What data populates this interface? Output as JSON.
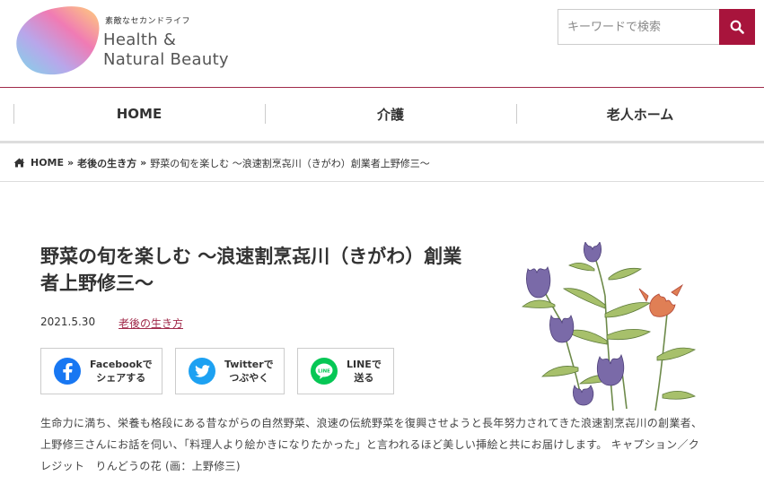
{
  "header": {
    "tagline": "素敵なセカンドライフ",
    "brand_line1": "Health &",
    "brand_line2": "Natural Beauty",
    "search_placeholder": "キーワードで検索"
  },
  "nav": {
    "items": [
      {
        "label": "HOME"
      },
      {
        "label": "介護"
      },
      {
        "label": "老人ホーム"
      }
    ]
  },
  "breadcrumb": {
    "home": "HOME",
    "category": "老後の生き方",
    "current": "野菜の旬を楽しむ 〜浪速割烹㐂川（きがわ）創業者上野修三〜",
    "separator": "»"
  },
  "article": {
    "title": "野菜の旬を楽しむ 〜浪速割烹㐂川（きがわ）創業者上野修三〜",
    "date": "2021.5.30",
    "category": "老後の生き方",
    "share": {
      "facebook": "Facebookで\nシェアする",
      "twitter": "Twitterで\nつぶやく",
      "line": "LINEで\n送る"
    },
    "body": "生命力に満ち、栄養も格段にある昔ながらの自然野菜、浪速の伝統野菜を復興させようと長年努力されてきた浪速割烹㐂川の創業者、上野修三さんにお話を伺い、「料理人より絵かきになりたかった」と言われるほど美しい挿絵と共にお届けします。 キャプション／クレジット　りんどうの花 (画：上野修三)"
  },
  "colors": {
    "accent": "#a8143c",
    "facebook": "#1877f2",
    "twitter": "#1da1f2",
    "line": "#06c755"
  }
}
